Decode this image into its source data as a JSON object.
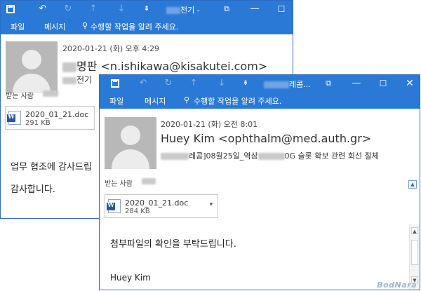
{
  "back_window": {
    "title_visible": "전기 -",
    "tabs": {
      "file": "파일",
      "message": "메시지"
    },
    "tell_me": "수행할 작업을 알려 주세요.",
    "date": "2020-01-21 (화) 오후 4:29",
    "sender_visible": "명판 <n.ishikawa@kisakutei.com>",
    "sender_org_visible": "전기",
    "to_label": "받는 사람",
    "attachment": {
      "name": "2020_01_21.doc",
      "size": "291 KB"
    },
    "body_line1_visible": "업무 협조에 감사드립",
    "body_line2": "감사합니다."
  },
  "front_window": {
    "title_visible": "레콤...",
    "tabs": {
      "file": "파일",
      "message": "메시지"
    },
    "tell_me": "수행할 작업을 알려 주세요.",
    "date": "2020-01-21 (화) 오전 8:01",
    "sender": "Huey Kim <ophthalm@med.auth.gr>",
    "subject_part1": "레콤]08월25일_역삼",
    "subject_part2": "0G 슬롯 확보 관련 회선 절체",
    "to_label": "받는 사람",
    "attachment": {
      "name": "2020_01_21.doc",
      "size": "284 KB"
    },
    "body_line1": "첨부파일의 확인을 부탁드립니다.",
    "body_line2": "Huey Kim"
  },
  "watermark": "BodNara",
  "icons": [
    "save-icon",
    "undo-icon",
    "redo-icon",
    "up-icon",
    "down-icon",
    "more-icon",
    "restore-icon",
    "minimize-icon",
    "maximize-icon",
    "close-icon",
    "lightbulb-icon",
    "word-doc-icon",
    "chevron-down-icon",
    "collapse-icon"
  ],
  "colors": {
    "titlebar": "#2b79d6",
    "accent": "#2b579a"
  }
}
